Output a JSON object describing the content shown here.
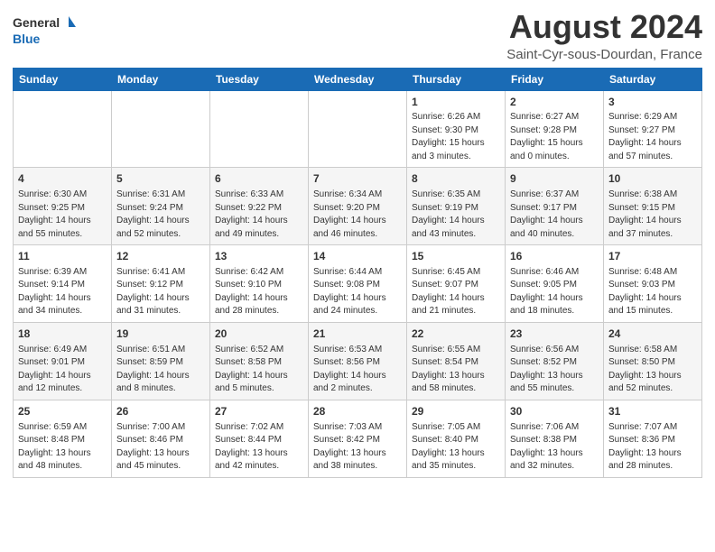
{
  "header": {
    "logo_line1": "General",
    "logo_line2": "Blue",
    "title": "August 2024",
    "subtitle": "Saint-Cyr-sous-Dourdan, France"
  },
  "columns": [
    "Sunday",
    "Monday",
    "Tuesday",
    "Wednesday",
    "Thursday",
    "Friday",
    "Saturday"
  ],
  "weeks": [
    [
      {
        "day": "",
        "info": ""
      },
      {
        "day": "",
        "info": ""
      },
      {
        "day": "",
        "info": ""
      },
      {
        "day": "",
        "info": ""
      },
      {
        "day": "1",
        "info": "Sunrise: 6:26 AM\nSunset: 9:30 PM\nDaylight: 15 hours\nand 3 minutes."
      },
      {
        "day": "2",
        "info": "Sunrise: 6:27 AM\nSunset: 9:28 PM\nDaylight: 15 hours\nand 0 minutes."
      },
      {
        "day": "3",
        "info": "Sunrise: 6:29 AM\nSunset: 9:27 PM\nDaylight: 14 hours\nand 57 minutes."
      }
    ],
    [
      {
        "day": "4",
        "info": "Sunrise: 6:30 AM\nSunset: 9:25 PM\nDaylight: 14 hours\nand 55 minutes."
      },
      {
        "day": "5",
        "info": "Sunrise: 6:31 AM\nSunset: 9:24 PM\nDaylight: 14 hours\nand 52 minutes."
      },
      {
        "day": "6",
        "info": "Sunrise: 6:33 AM\nSunset: 9:22 PM\nDaylight: 14 hours\nand 49 minutes."
      },
      {
        "day": "7",
        "info": "Sunrise: 6:34 AM\nSunset: 9:20 PM\nDaylight: 14 hours\nand 46 minutes."
      },
      {
        "day": "8",
        "info": "Sunrise: 6:35 AM\nSunset: 9:19 PM\nDaylight: 14 hours\nand 43 minutes."
      },
      {
        "day": "9",
        "info": "Sunrise: 6:37 AM\nSunset: 9:17 PM\nDaylight: 14 hours\nand 40 minutes."
      },
      {
        "day": "10",
        "info": "Sunrise: 6:38 AM\nSunset: 9:15 PM\nDaylight: 14 hours\nand 37 minutes."
      }
    ],
    [
      {
        "day": "11",
        "info": "Sunrise: 6:39 AM\nSunset: 9:14 PM\nDaylight: 14 hours\nand 34 minutes."
      },
      {
        "day": "12",
        "info": "Sunrise: 6:41 AM\nSunset: 9:12 PM\nDaylight: 14 hours\nand 31 minutes."
      },
      {
        "day": "13",
        "info": "Sunrise: 6:42 AM\nSunset: 9:10 PM\nDaylight: 14 hours\nand 28 minutes."
      },
      {
        "day": "14",
        "info": "Sunrise: 6:44 AM\nSunset: 9:08 PM\nDaylight: 14 hours\nand 24 minutes."
      },
      {
        "day": "15",
        "info": "Sunrise: 6:45 AM\nSunset: 9:07 PM\nDaylight: 14 hours\nand 21 minutes."
      },
      {
        "day": "16",
        "info": "Sunrise: 6:46 AM\nSunset: 9:05 PM\nDaylight: 14 hours\nand 18 minutes."
      },
      {
        "day": "17",
        "info": "Sunrise: 6:48 AM\nSunset: 9:03 PM\nDaylight: 14 hours\nand 15 minutes."
      }
    ],
    [
      {
        "day": "18",
        "info": "Sunrise: 6:49 AM\nSunset: 9:01 PM\nDaylight: 14 hours\nand 12 minutes."
      },
      {
        "day": "19",
        "info": "Sunrise: 6:51 AM\nSunset: 8:59 PM\nDaylight: 14 hours\nand 8 minutes."
      },
      {
        "day": "20",
        "info": "Sunrise: 6:52 AM\nSunset: 8:58 PM\nDaylight: 14 hours\nand 5 minutes."
      },
      {
        "day": "21",
        "info": "Sunrise: 6:53 AM\nSunset: 8:56 PM\nDaylight: 14 hours\nand 2 minutes."
      },
      {
        "day": "22",
        "info": "Sunrise: 6:55 AM\nSunset: 8:54 PM\nDaylight: 13 hours\nand 58 minutes."
      },
      {
        "day": "23",
        "info": "Sunrise: 6:56 AM\nSunset: 8:52 PM\nDaylight: 13 hours\nand 55 minutes."
      },
      {
        "day": "24",
        "info": "Sunrise: 6:58 AM\nSunset: 8:50 PM\nDaylight: 13 hours\nand 52 minutes."
      }
    ],
    [
      {
        "day": "25",
        "info": "Sunrise: 6:59 AM\nSunset: 8:48 PM\nDaylight: 13 hours\nand 48 minutes."
      },
      {
        "day": "26",
        "info": "Sunrise: 7:00 AM\nSunset: 8:46 PM\nDaylight: 13 hours\nand 45 minutes."
      },
      {
        "day": "27",
        "info": "Sunrise: 7:02 AM\nSunset: 8:44 PM\nDaylight: 13 hours\nand 42 minutes."
      },
      {
        "day": "28",
        "info": "Sunrise: 7:03 AM\nSunset: 8:42 PM\nDaylight: 13 hours\nand 38 minutes."
      },
      {
        "day": "29",
        "info": "Sunrise: 7:05 AM\nSunset: 8:40 PM\nDaylight: 13 hours\nand 35 minutes."
      },
      {
        "day": "30",
        "info": "Sunrise: 7:06 AM\nSunset: 8:38 PM\nDaylight: 13 hours\nand 32 minutes."
      },
      {
        "day": "31",
        "info": "Sunrise: 7:07 AM\nSunset: 8:36 PM\nDaylight: 13 hours\nand 28 minutes."
      }
    ]
  ]
}
